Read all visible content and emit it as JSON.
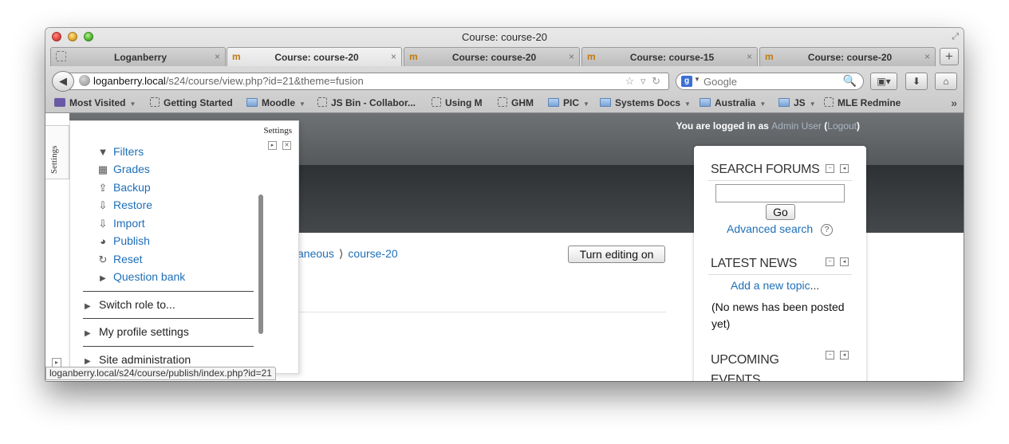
{
  "window": {
    "title": "Course: course-20"
  },
  "tabs": [
    {
      "label": "Loganberry",
      "favicon": "blank"
    },
    {
      "label": "Course: course-20",
      "favicon": "moodle"
    },
    {
      "label": "Course: course-20",
      "favicon": "moodle"
    },
    {
      "label": "Course: course-15",
      "favicon": "moodle"
    },
    {
      "label": "Course: course-20",
      "favicon": "moodle"
    }
  ],
  "active_tab_index": 1,
  "favicon_glyph": "m",
  "tab_close_glyph": "×",
  "newtab_glyph": "+",
  "navbar": {
    "url_host": "loganberry.local",
    "url_path": "/s24/course/view.php?id=21&theme=fusion",
    "search_placeholder": "Google",
    "search_engine_glyph": "g"
  },
  "bookmarks": [
    {
      "label": "Most Visited",
      "icon": "smart-folder",
      "dropdown": true
    },
    {
      "label": "Getting Started",
      "icon": "page",
      "dropdown": false
    },
    {
      "label": "Moodle",
      "icon": "folder",
      "dropdown": true
    },
    {
      "label": "JS Bin - Collabor...",
      "icon": "page",
      "dropdown": false
    },
    {
      "label": "Using M",
      "icon": "page",
      "dropdown": false
    },
    {
      "label": "GHM",
      "icon": "page",
      "dropdown": false
    },
    {
      "label": "PIC",
      "icon": "folder",
      "dropdown": true
    },
    {
      "label": "Systems Docs",
      "icon": "folder",
      "dropdown": true
    },
    {
      "label": "Australia",
      "icon": "folder",
      "dropdown": true
    },
    {
      "label": "JS",
      "icon": "folder",
      "dropdown": true
    },
    {
      "label": "MLE Redmine",
      "icon": "page",
      "dropdown": false
    }
  ],
  "bookmarks_more_glyph": "»",
  "sidetab": {
    "label": "Settings"
  },
  "header": {
    "login_prefix": "You are logged in as ",
    "user_name": "Admin User",
    "logout_open": " (",
    "logout_label": "Logout",
    "logout_close": ")"
  },
  "breadcrumb": {
    "partial": "aneous",
    "separator": "⟩",
    "current": "course-20"
  },
  "edit_button_label": "Turn editing on",
  "settings_panel": {
    "title": "Settings",
    "items": [
      {
        "label": "Filters",
        "icon": "filter-icon",
        "glyph": "▼"
      },
      {
        "label": "Grades",
        "icon": "grades-icon",
        "glyph": "▦"
      },
      {
        "label": "Backup",
        "icon": "backup-icon",
        "glyph": "⇪"
      },
      {
        "label": "Restore",
        "icon": "restore-icon",
        "glyph": "⇩"
      },
      {
        "label": "Import",
        "icon": "import-icon",
        "glyph": "⇩"
      },
      {
        "label": "Publish",
        "icon": "publish-icon",
        "glyph": "◕"
      },
      {
        "label": "Reset",
        "icon": "reset-icon",
        "glyph": "↻"
      },
      {
        "label": "Question bank",
        "icon": "expand-icon",
        "glyph": "▶"
      }
    ],
    "sections": [
      {
        "label": "Switch role to..."
      },
      {
        "label": "My profile settings"
      },
      {
        "label": "Site administration"
      }
    ]
  },
  "blocks": {
    "search_forums": {
      "title": "SEARCH FORUMS",
      "go_label": "Go",
      "advanced_label": "Advanced search",
      "help_glyph": "?"
    },
    "latest_news": {
      "title": "LATEST NEWS",
      "add_topic": "Add a new topic",
      "add_topic_suffix": "...",
      "empty": "(No news has been posted yet)"
    },
    "upcoming_events": {
      "title": "UPCOMING EVENTS"
    }
  },
  "status_url": "loganberry.local/s24/course/publish/index.php?id=21",
  "colors": {
    "link": "#1e6fb8",
    "header_dark": "#2f3235",
    "login_link": "#a9b6c2"
  }
}
